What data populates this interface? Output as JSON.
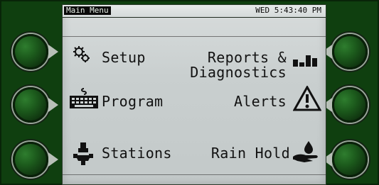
{
  "header": {
    "menu_label": "Main Menu",
    "datetime": "WED 5:43:40 PM"
  },
  "menu": {
    "setup": "Setup",
    "reports": "Reports &",
    "diagnostics": "Diagnostics",
    "program": "Program",
    "alerts": "Alerts",
    "stations": "Stations",
    "rain_hold": "Rain Hold"
  },
  "icons": {
    "setup": "gear-icon",
    "reports": "bar-chart-icon",
    "program": "keyboard-icon",
    "alerts": "warning-icon",
    "stations": "valve-icon",
    "rain_hold": "hand-drop-icon"
  },
  "colors": {
    "bezel": "#0f3f0f",
    "button_green": "#1c5a1c",
    "screen": "#cfd4d4",
    "text": "#121212"
  }
}
